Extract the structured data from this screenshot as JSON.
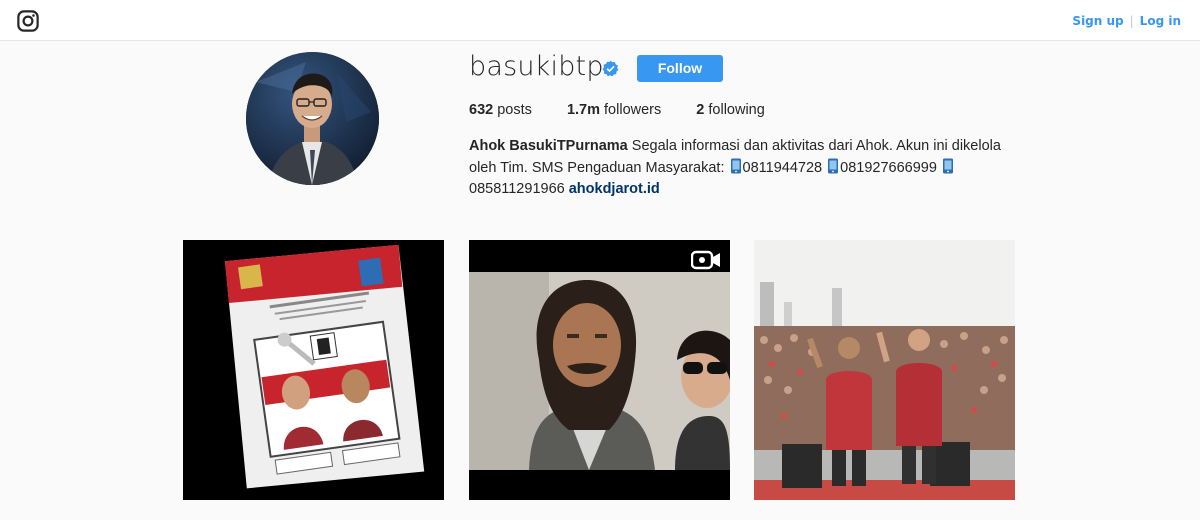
{
  "nav": {
    "signup_label": "Sign up",
    "login_label": "Log in",
    "logo_icon": "instagram-camera-icon"
  },
  "profile": {
    "username": "basukibtp",
    "verified_icon": "verified-badge-icon",
    "follow_label": "Follow",
    "stats": {
      "posts_count": "632",
      "posts_label": "posts",
      "followers_count": "1.7m",
      "followers_label": "followers",
      "following_count": "2",
      "following_label": "following"
    },
    "bio": {
      "full_name": "Ahok BasukiTPurnama",
      "text": "Segala informasi dan aktivitas dari Ahok. Akun ini dikelola oleh Tim. SMS Pengaduan Masyarakat:",
      "phone_1": "0811944728",
      "phone_2": "081927666999",
      "phone_3": "085811291966",
      "link": "ahokdjarot.id"
    }
  },
  "posts": [
    {
      "kind": "image",
      "icon": null
    },
    {
      "kind": "video",
      "icon": "video-camera-icon"
    },
    {
      "kind": "image",
      "icon": null
    }
  ],
  "colors": {
    "accent": "#3897f0",
    "link": "#003569",
    "background": "#fafafa"
  }
}
